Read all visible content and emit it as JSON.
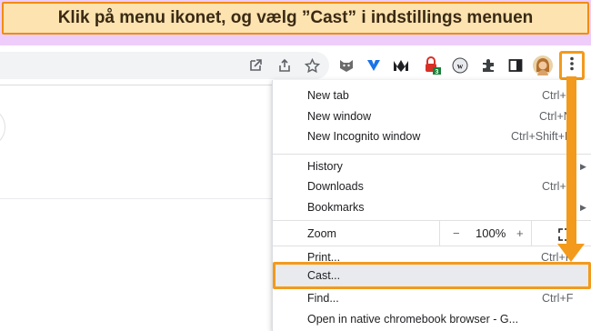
{
  "banner": {
    "text": "Klik på menu ikonet, og vælg ”Cast” i indstillings menuen"
  },
  "toolbar": {
    "omnibox_icons": [
      "open-in-new-icon",
      "share-icon",
      "star-icon"
    ],
    "extensions": [
      {
        "name": "extension-fox-icon",
        "color": "#6b6b6b"
      },
      {
        "name": "extension-v-icon",
        "color": "#1a73e8"
      },
      {
        "name": "extension-m-icon",
        "color": "#202124"
      },
      {
        "name": "extension-lock-icon",
        "color": "#d93025",
        "badge": "3"
      },
      {
        "name": "extension-w-icon",
        "color": "#3c4043"
      },
      {
        "name": "extensions-puzzle-icon",
        "color": "#3c4043"
      },
      {
        "name": "side-panel-icon",
        "color": "#202124"
      }
    ],
    "menu_button": "kebab-menu-icon",
    "highlight_color": "#f39a1c"
  },
  "menu": {
    "items": [
      {
        "label": "New tab",
        "shortcut": "Ctrl+T"
      },
      {
        "label": "New window",
        "shortcut": "Ctrl+N"
      },
      {
        "label": "New Incognito window",
        "shortcut": "Ctrl+Shift+N"
      },
      {
        "label": "History",
        "submenu": true
      },
      {
        "label": "Downloads",
        "shortcut": "Ctrl+J"
      },
      {
        "label": "Bookmarks",
        "submenu": true
      },
      {
        "label": "Print...",
        "shortcut": "Ctrl+P"
      },
      {
        "label": "Cast..."
      },
      {
        "label": "Find...",
        "shortcut": "Ctrl+F"
      },
      {
        "label": "Open in native chromebook browser - G..."
      }
    ],
    "zoom": {
      "label": "Zoom",
      "minus": "−",
      "value": "100%",
      "plus": "+"
    }
  }
}
